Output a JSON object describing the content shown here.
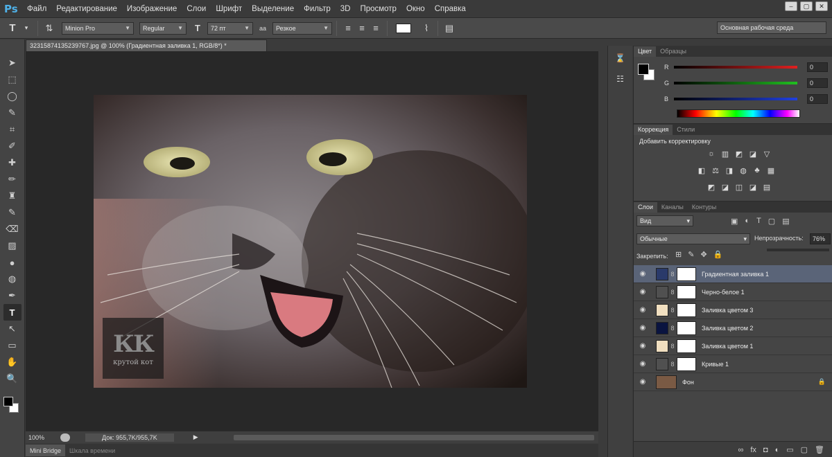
{
  "app": {
    "logo": "Ps"
  },
  "menu": [
    "Файл",
    "Редактирование",
    "Изображение",
    "Слои",
    "Шрифт",
    "Выделение",
    "Фильтр",
    "3D",
    "Просмотр",
    "Окно",
    "Справка"
  ],
  "options": {
    "tool_glyph": "T",
    "font_family": "Minion Pro",
    "font_style": "Regular",
    "font_size": "72 пт",
    "aa_prefix": "aa",
    "antialias": "Резкое",
    "workspace": "Основная рабочая среда"
  },
  "document": {
    "tab_title": "32315874135239767.jpg @ 100% (Градиентная заливка 1, RGB/8*) *",
    "watermark_big": "КК",
    "watermark_small": "крутой кот"
  },
  "status": {
    "zoom": "100%",
    "doc_size": "Док: 955,7K/955,7K",
    "arrow": "▶"
  },
  "bottom_tabs": [
    "Mini Bridge",
    "Шкала времени"
  ],
  "color_panel": {
    "tabs": [
      "Цвет",
      "Образцы"
    ],
    "channels": [
      {
        "label": "R",
        "value": "0",
        "color": "#e02020"
      },
      {
        "label": "G",
        "value": "0",
        "color": "#20c020"
      },
      {
        "label": "B",
        "value": "0",
        "color": "#2040e0"
      }
    ]
  },
  "adjustments": {
    "tabs": [
      "Коррекция",
      "Стили"
    ],
    "title": "Добавить корректировку",
    "row1": [
      "☼",
      "▥",
      "◩",
      "◪",
      "▽"
    ],
    "row2": [
      "◧",
      "⚖",
      "◨",
      "◍",
      "♣",
      "▦"
    ],
    "row3": [
      "◩",
      "◪",
      "◫",
      "◪",
      "▤"
    ]
  },
  "layers_panel": {
    "tabs": [
      "Слои",
      "Каналы",
      "Контуры"
    ],
    "filter": "Вид",
    "blend_mode": "Обычные",
    "opacity_label": "Непрозрачность:",
    "opacity_value": "76%",
    "lock_label": "Закрепить:",
    "layers": [
      {
        "name": "Градиентная заливка 1",
        "thumb": "#2a3a6a",
        "selected": true,
        "eye": "◉",
        "link": "8"
      },
      {
        "name": "Черно-белое 1",
        "thumb": "#505050",
        "selected": false,
        "eye": "◉",
        "link": "8"
      },
      {
        "name": "Заливка цветом 3",
        "thumb": "#f1dfc0",
        "selected": false,
        "eye": "◉",
        "link": "8"
      },
      {
        "name": "Заливка цветом 2",
        "thumb": "#0a1440",
        "selected": false,
        "eye": "◉",
        "link": "8"
      },
      {
        "name": "Заливка цветом 1",
        "thumb": "#f1dfc0",
        "selected": false,
        "eye": "◉",
        "link": "8"
      },
      {
        "name": "Кривые 1",
        "thumb": "#505050",
        "selected": false,
        "eye": "◉",
        "link": "8"
      },
      {
        "name": "Фон",
        "thumb": "#7a5a44",
        "selected": false,
        "eye": "◉",
        "link": ""
      }
    ],
    "footer_icons": [
      "∞",
      "fx",
      "◘",
      "◐",
      "▭",
      "▢",
      "🗑"
    ]
  },
  "tools": [
    "➤",
    "⬚",
    "◯",
    "✎",
    "⌗",
    "✐",
    "✚",
    "✏",
    "♜",
    "✎",
    "⌫",
    "▨",
    "●",
    "◍",
    "✒",
    "T",
    "↖",
    "▭",
    "✋",
    "🔍"
  ]
}
